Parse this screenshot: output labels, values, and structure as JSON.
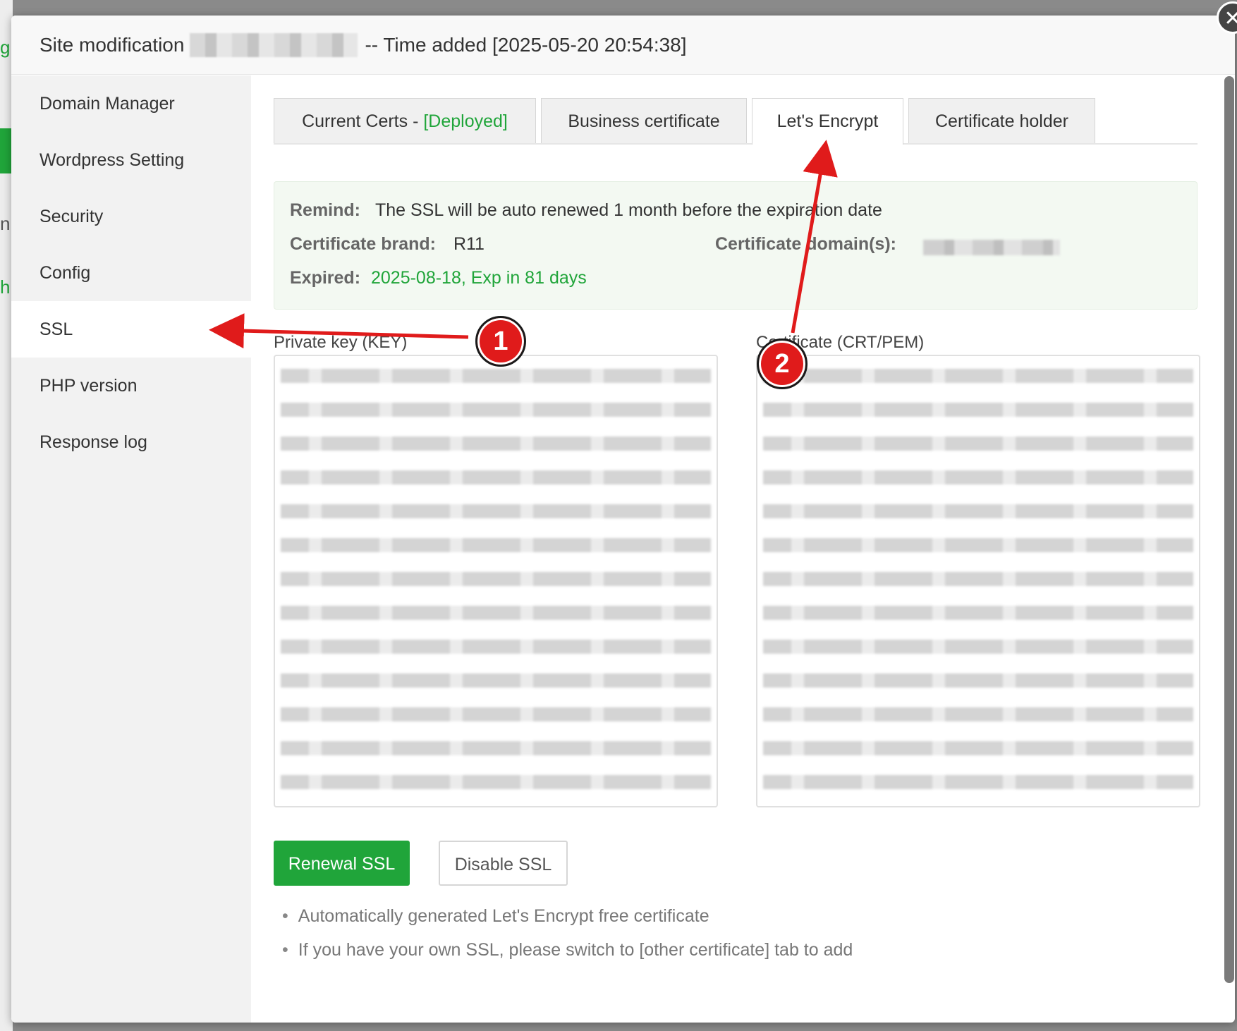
{
  "header": {
    "title": "Site modification",
    "time_added": "-- Time added [2025-05-20 20:54:38]"
  },
  "sidebar": {
    "items": [
      {
        "label": "Domain Manager"
      },
      {
        "label": "Wordpress Setting"
      },
      {
        "label": "Security"
      },
      {
        "label": "Config"
      },
      {
        "label": "SSL",
        "active": true
      },
      {
        "label": "PHP version"
      },
      {
        "label": "Response log"
      }
    ]
  },
  "tabs": {
    "current_certs": "Current Certs - ",
    "current_status": "[Deployed]",
    "business": "Business certificate",
    "lets_encrypt": "Let's Encrypt",
    "holder": "Certificate holder",
    "active": "Let's Encrypt"
  },
  "info": {
    "remind_label": "Remind:",
    "remind_text": "The SSL will be auto renewed 1 month before the expiration date",
    "brand_label": "Certificate brand:",
    "brand_value": "R11",
    "domains_label": "Certificate domain(s):",
    "expired_label": "Expired:",
    "expired_value": "2025-08-18, Exp in 81 days"
  },
  "fields": {
    "key_label": "Private key (KEY)",
    "cert_label": "Certificate (CRT/PEM)"
  },
  "buttons": {
    "renew": "Renewal SSL",
    "disable": "Disable SSL"
  },
  "notes": [
    "Automatically generated Let's Encrypt free certificate",
    "If you have your own SSL, please switch to [other certificate] tab to add"
  ],
  "annotations": {
    "badge_1": "1",
    "badge_2": "2",
    "color": "#e01b1b"
  },
  "colors": {
    "accent_green": "#20a53a",
    "info_bg": "#f3f9f2"
  }
}
